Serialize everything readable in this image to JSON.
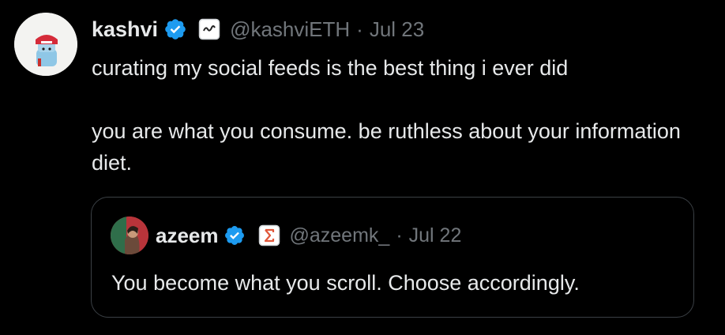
{
  "tweet": {
    "author": {
      "display_name": "kashvi",
      "handle": "@kashviETH",
      "verified_icon": "verified-badge-icon",
      "affiliation_icon": "affiliation-badge-icon",
      "avatar": "user-avatar"
    },
    "separator": "·",
    "date": "Jul 23",
    "text": {
      "line1": "curating my social feeds is the best thing i ever did",
      "line2": "you are what you consume. be ruthless about your information diet."
    },
    "quote": {
      "author": {
        "display_name": "azeem",
        "handle": "@azeemk_",
        "verified_icon": "verified-badge-icon",
        "affiliation_icon": "affiliation-badge-icon",
        "avatar": "user-avatar"
      },
      "separator": "·",
      "date": "Jul 22",
      "text": "You become what you scroll. Choose accordingly."
    }
  },
  "colors": {
    "background": "#000000",
    "primary_text": "#e7e9ea",
    "secondary_text": "#71767b",
    "verified_blue": "#1d9bf0",
    "quote_border": "#3b4045"
  }
}
